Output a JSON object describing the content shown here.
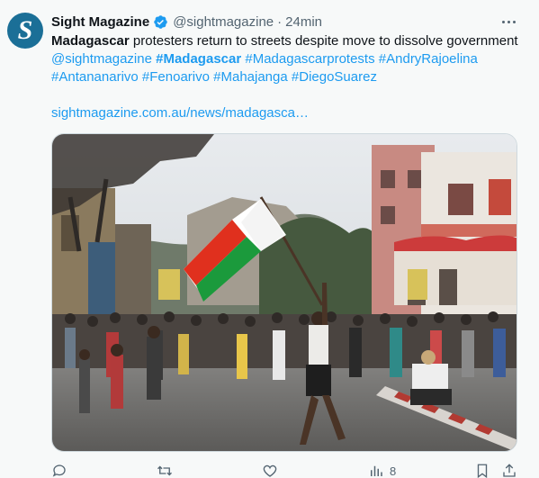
{
  "tweet": {
    "author_name": "Sight Magazine",
    "handle": "@sightmagazine",
    "separator": "·",
    "time": "24min",
    "avatar_letter": "S",
    "text_bold": "Madagascar",
    "text_rest": " protesters return to streets despite move to dissolve government ",
    "mention": "@sightmagazine",
    "hashtag_highlight": "#Madagascar",
    "hashtags": [
      "#Madagascarprotests",
      "#AndryRajoelina",
      "#Antananarivo",
      "#Fenoarivo",
      "#Mahajanga",
      "#DiegoSuarez"
    ],
    "url": "sightmagazine.com.au/news/madagasca…",
    "views_count": "8"
  },
  "icons": {
    "verified": "verified-badge-icon",
    "more": "more-options-icon",
    "reply": "reply-icon",
    "retweet": "retweet-icon",
    "like": "like-icon",
    "views": "views-icon",
    "bookmark": "bookmark-icon",
    "share": "share-icon"
  },
  "colors": {
    "accent": "#1d9bf0",
    "muted": "#536471",
    "avatar": "#1b6f97",
    "flag_white": "#ffffff",
    "flag_red": "#e0301e",
    "flag_green": "#1b9a3c"
  }
}
